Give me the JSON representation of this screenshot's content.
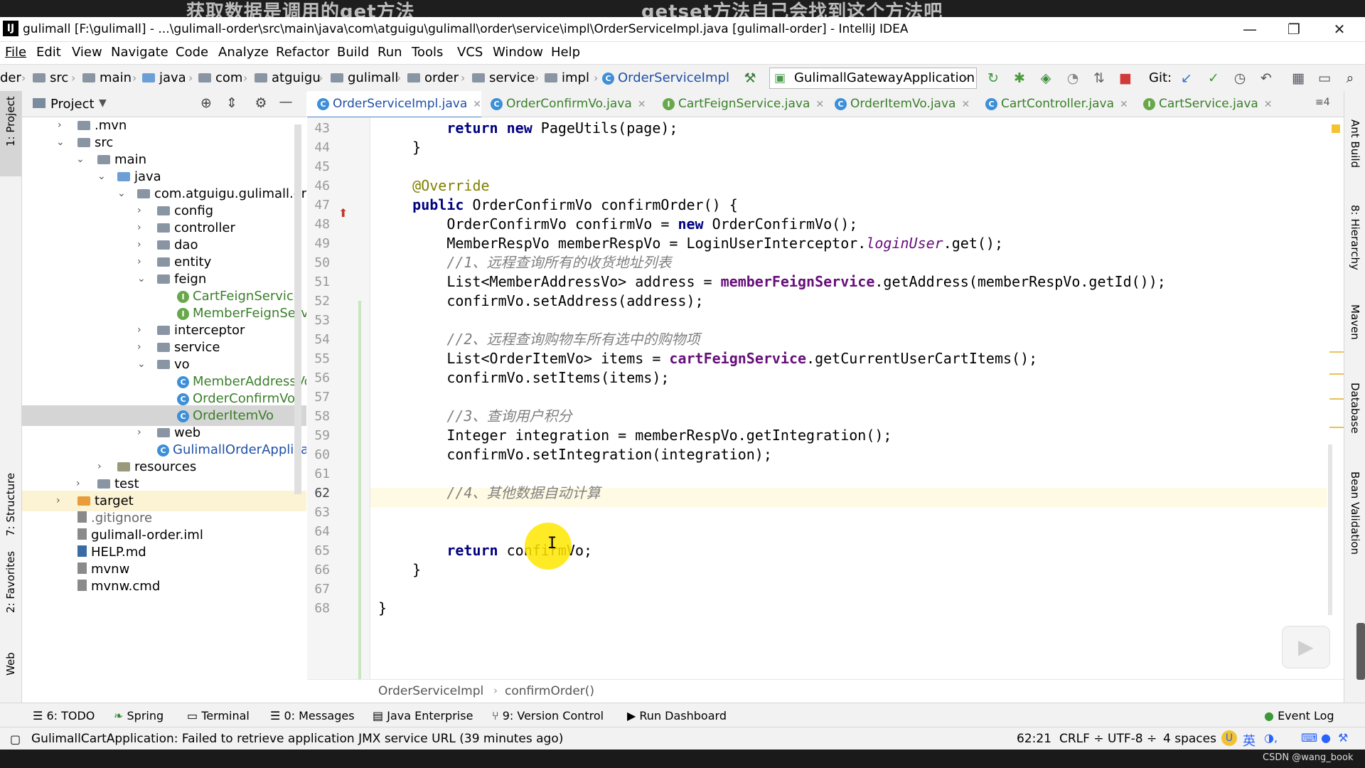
{
  "captions": {
    "left": "获取数据是调用的get方法",
    "right": "getset方法自己会找到这个方法吧"
  },
  "window": {
    "title": "gulimall [F:\\gulimall] - ...\\gulimall-order\\src\\main\\java\\com\\atguigu\\gulimall\\order\\service\\impl\\OrderServiceImpl.java [gulimall-order] - IntelliJ IDEA",
    "logo": "IJ",
    "minimize": "—",
    "restore": "❐",
    "close": "✕"
  },
  "menu": [
    "File",
    "Edit",
    "View",
    "Navigate",
    "Code",
    "Analyze",
    "Refactor",
    "Build",
    "Run",
    "Tools",
    "VCS",
    "Window",
    "Help"
  ],
  "nav": {
    "crumbs": [
      "der",
      "src",
      "main",
      "java",
      "com",
      "atguigu",
      "gulimall",
      "order",
      "service",
      "impl",
      "OrderServiceImpl"
    ],
    "run_config": "GulimallGatewayApplication",
    "git_label": "Git:"
  },
  "left_stripe": {
    "project": "1: Project",
    "structure": "7: Structure",
    "favorites": "2: Favorites",
    "web": "Web"
  },
  "right_stripe": {
    "ant": "Ant Build",
    "hierarchy": "8: Hierarchy",
    "maven": "Maven",
    "database": "Database",
    "bean": "Bean Validation"
  },
  "project_panel": {
    "title": "Project",
    "tree": [
      {
        "label": ".mvn",
        "type": "folder",
        "chev": "›"
      },
      {
        "label": "src",
        "type": "folder",
        "chev": "⌄"
      },
      {
        "label": "main",
        "type": "folder",
        "chev": "⌄"
      },
      {
        "label": "java",
        "type": "folder-blue",
        "chev": "⌄"
      },
      {
        "label": "com.atguigu.gulimall.orde",
        "type": "folder",
        "chev": "⌄"
      },
      {
        "label": "config",
        "type": "folder",
        "chev": "›"
      },
      {
        "label": "controller",
        "type": "folder",
        "chev": "›"
      },
      {
        "label": "dao",
        "type": "folder",
        "chev": "›"
      },
      {
        "label": "entity",
        "type": "folder",
        "chev": "›"
      },
      {
        "label": "feign",
        "type": "folder",
        "chev": "⌄"
      },
      {
        "label": "CartFeignService",
        "type": "interface",
        "chev": ""
      },
      {
        "label": "MemberFeignServic",
        "type": "interface",
        "chev": ""
      },
      {
        "label": "interceptor",
        "type": "folder",
        "chev": "›"
      },
      {
        "label": "service",
        "type": "folder",
        "chev": "›"
      },
      {
        "label": "vo",
        "type": "folder",
        "chev": "⌄"
      },
      {
        "label": "MemberAddressVo",
        "type": "class",
        "chev": ""
      },
      {
        "label": "OrderConfirmVo",
        "type": "class",
        "chev": ""
      },
      {
        "label": "OrderItemVo",
        "type": "class",
        "chev": "",
        "selected": true
      },
      {
        "label": "web",
        "type": "folder",
        "chev": "›"
      },
      {
        "label": "GulimallOrderApplicati",
        "type": "class-app",
        "chev": ""
      },
      {
        "label": "resources",
        "type": "folder",
        "chev": "›"
      },
      {
        "label": "test",
        "type": "folder",
        "chev": "›"
      },
      {
        "label": "target",
        "type": "folder-orange",
        "chev": "›"
      },
      {
        "label": ".gitignore",
        "type": "file",
        "chev": ""
      },
      {
        "label": "gulimall-order.iml",
        "type": "file",
        "chev": ""
      },
      {
        "label": "HELP.md",
        "type": "file",
        "chev": ""
      },
      {
        "label": "mvnw",
        "type": "file",
        "chev": ""
      },
      {
        "label": "mvnw.cmd",
        "type": "file",
        "chev": ""
      }
    ]
  },
  "tabs": [
    {
      "label": "OrderServiceImpl.java",
      "icon": "C",
      "active": true
    },
    {
      "label": "OrderConfirmVo.java",
      "icon": "C"
    },
    {
      "label": "CartFeignService.java",
      "icon": "I"
    },
    {
      "label": "OrderItemVo.java",
      "icon": "C"
    },
    {
      "label": "CartController.java",
      "icon": "C"
    },
    {
      "label": "CartService.java",
      "icon": "I"
    }
  ],
  "tab_overflow": "≡4",
  "editor": {
    "lines": [
      {
        "n": "43",
        "html": "        <span class=\"kw\">return new</span> PageUtils(page);"
      },
      {
        "n": "44",
        "html": "    }"
      },
      {
        "n": "45",
        "html": ""
      },
      {
        "n": "46",
        "html": "    <span class=\"an\">@Override</span>"
      },
      {
        "n": "47",
        "html": "    <span class=\"kw\">public</span> OrderConfirmVo confirmOrder() {"
      },
      {
        "n": "48",
        "html": "        OrderConfirmVo confirmVo = <span class=\"kw\">new</span> OrderConfirmVo();"
      },
      {
        "n": "49",
        "html": "        MemberRespVo memberRespVo = LoginUserInterceptor.<span class=\"sfld\">loginUser</span>.get();"
      },
      {
        "n": "50",
        "html": "        <span class=\"cm\">//1、远程查询所有的收货地址列表</span>"
      },
      {
        "n": "51",
        "html": "        List&lt;MemberAddressVo&gt; address = <span class=\"fld\">memberFeignService</span>.getAddress(memberRespVo.getId());"
      },
      {
        "n": "52",
        "html": "        confirmVo.setAddress(address);"
      },
      {
        "n": "53",
        "html": ""
      },
      {
        "n": "54",
        "html": "        <span class=\"cm\">//2、远程查询购物车所有选中的购物项</span>"
      },
      {
        "n": "55",
        "html": "        List&lt;OrderItemVo&gt; items = <span class=\"fld\">cartFeignService</span>.getCurrentUserCartItems();"
      },
      {
        "n": "56",
        "html": "        confirmVo.setItems(items);"
      },
      {
        "n": "57",
        "html": ""
      },
      {
        "n": "58",
        "html": "        <span class=\"cm\">//3、查询用户积分</span>"
      },
      {
        "n": "59",
        "html": "        Integer integration = memberRespVo.getIntegration();"
      },
      {
        "n": "60",
        "html": "        confirmVo.setIntegration(integration);"
      },
      {
        "n": "61",
        "html": ""
      },
      {
        "n": "62",
        "html": "        <span class=\"cm\">//4、其他数据自动计算</span>"
      },
      {
        "n": "63",
        "html": ""
      },
      {
        "n": "64",
        "html": ""
      },
      {
        "n": "65",
        "html": "        <span class=\"kw\">return</span> confirmVo;"
      },
      {
        "n": "66",
        "html": "    }"
      },
      {
        "n": "67",
        "html": ""
      },
      {
        "n": "68",
        "html": "}"
      }
    ],
    "current_line": "62",
    "breadcrumb": [
      "OrderServiceImpl",
      "confirmOrder()"
    ]
  },
  "tool_windows": [
    {
      "label": "6: TODO",
      "icon": "☰"
    },
    {
      "label": "Spring",
      "icon": "❧"
    },
    {
      "label": "Terminal",
      "icon": "▭"
    },
    {
      "label": "0: Messages",
      "icon": "☰"
    },
    {
      "label": "Java Enterprise",
      "icon": "▤"
    },
    {
      "label": "9: Version Control",
      "icon": "⑂"
    },
    {
      "label": "Run Dashboard",
      "icon": "▶"
    }
  ],
  "event_log": "Event Log",
  "status": {
    "message": "GulimallCartApplication: Failed to retrieve application JMX service URL (39 minutes ago)",
    "position": "62:21",
    "line_sep": "CRLF ÷",
    "encoding": "UTF-8 ÷",
    "indent": "4 spaces",
    "ime": "英"
  },
  "watermark": "CSDN @wang_book"
}
